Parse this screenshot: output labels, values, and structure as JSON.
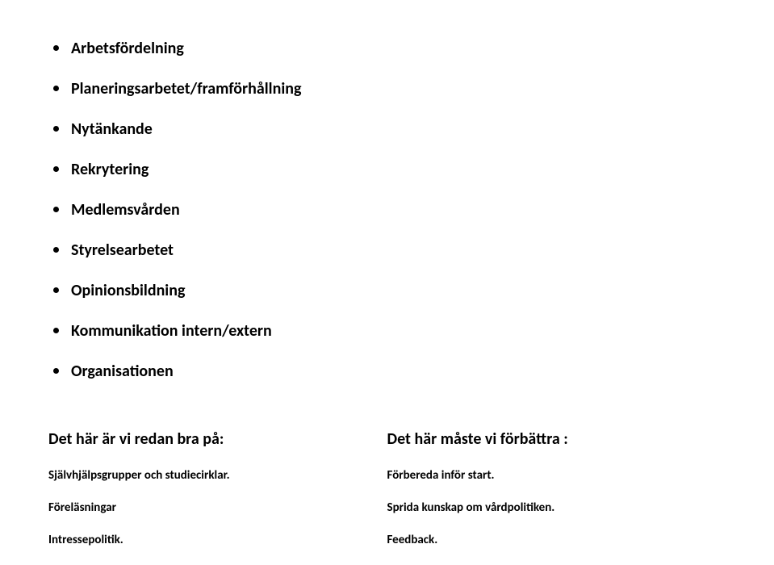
{
  "bullets": [
    "Arbetsfördelning",
    "Planeringsarbetet/framförhållning",
    "Nytänkande",
    "Rekrytering",
    "Medlemsvården",
    "Styrelsearbetet",
    "Opinionsbildning",
    "Kommunikation intern/extern",
    "Organisationen"
  ],
  "left": {
    "header": "Det här är vi redan bra på:",
    "items": [
      "Självhjälpsgrupper och studiecirklar.",
      "Föreläsningar",
      "Intressepolitik."
    ]
  },
  "right": {
    "header": "Det här måste vi förbättra :",
    "items": [
      "Förbereda inför start.",
      "Sprida kunskap om vårdpolitiken.",
      "Feedback."
    ]
  }
}
